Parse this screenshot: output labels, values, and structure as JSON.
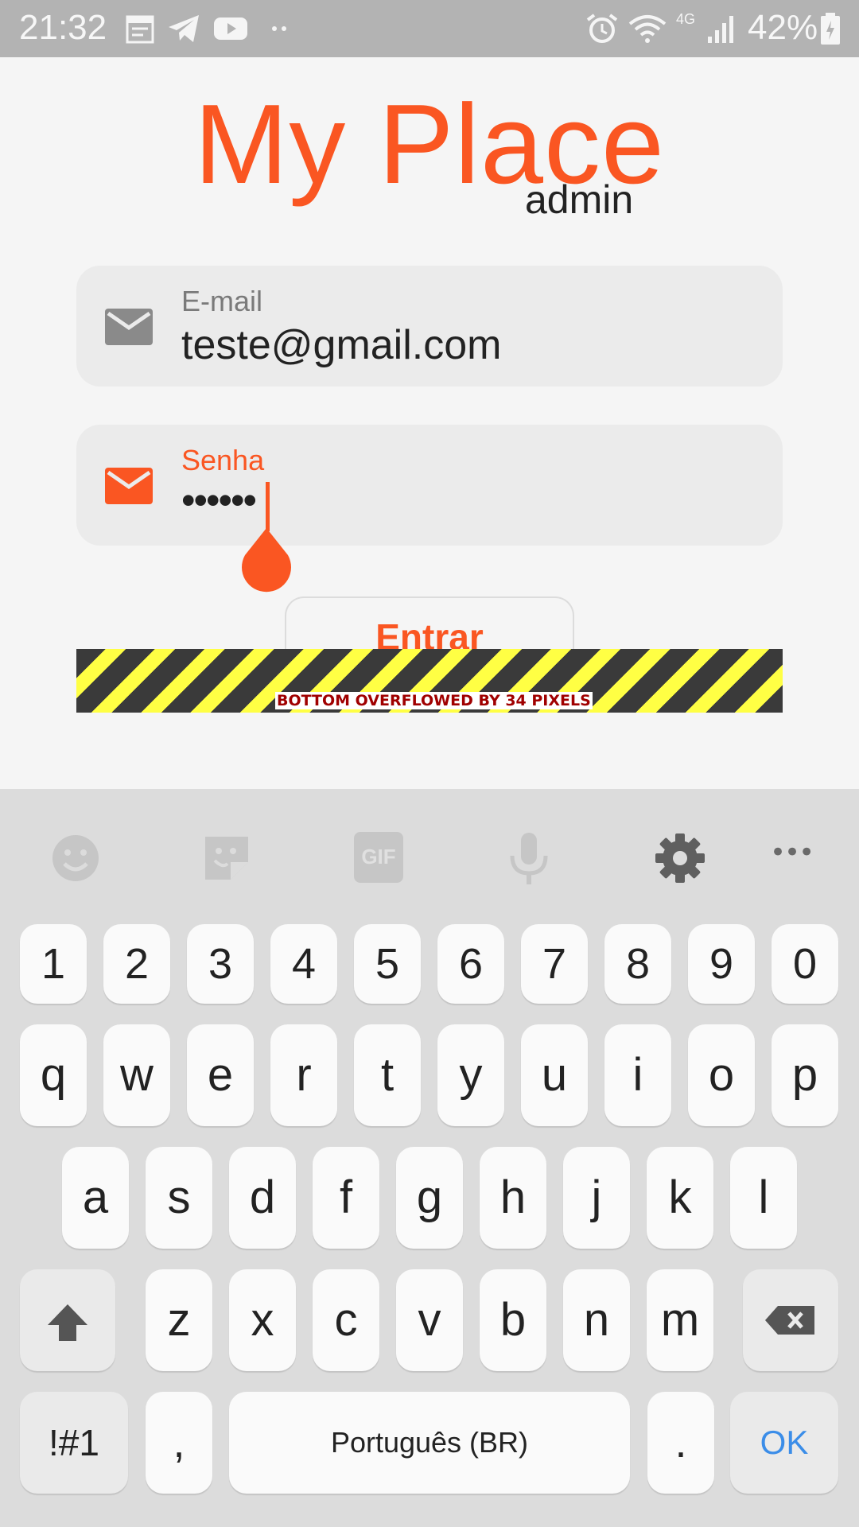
{
  "status_bar": {
    "time": "21:32",
    "battery": "42%",
    "network": "4G",
    "icons": [
      "calendar-icon",
      "telegram-icon",
      "youtube-icon",
      "more-icon",
      "alarm-icon",
      "wifi-icon",
      "signal-icon",
      "battery-icon"
    ]
  },
  "app": {
    "title": "My Place",
    "subtitle": "admin",
    "accent_color": "#fa5622",
    "email_field": {
      "label": "E-mail",
      "value": "teste@gmail.com"
    },
    "password_field": {
      "label": "Senha",
      "value": "••••••"
    },
    "enter_button": "Entrar",
    "overflow_warning": "BOTTOM OVERFLOWED BY 34 PIXELS"
  },
  "keyboard": {
    "toolbar": [
      "emoji-icon",
      "sticker-icon",
      "gif-icon",
      "microphone-icon",
      "settings-icon",
      "more-icon"
    ],
    "gif_label": "GIF",
    "more_label": "•••",
    "row_numbers": [
      "1",
      "2",
      "3",
      "4",
      "5",
      "6",
      "7",
      "8",
      "9",
      "0"
    ],
    "row1": [
      "q",
      "w",
      "e",
      "r",
      "t",
      "y",
      "u",
      "i",
      "o",
      "p"
    ],
    "row2": [
      "a",
      "s",
      "d",
      "f",
      "g",
      "h",
      "j",
      "k",
      "l"
    ],
    "row3": [
      "z",
      "x",
      "c",
      "v",
      "b",
      "n",
      "m"
    ],
    "symbols_key": "!#1",
    "comma_key": ",",
    "space_key": "Português (BR)",
    "period_key": ".",
    "ok_key": "OK"
  }
}
